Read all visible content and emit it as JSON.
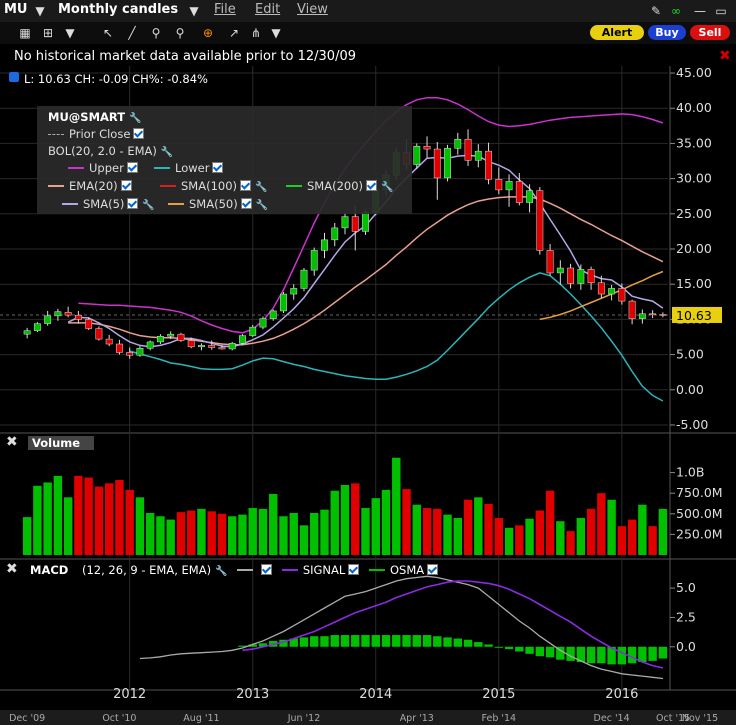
{
  "toolbar": {
    "symbol": "MU",
    "period": "Monthly candles",
    "menus": [
      "File",
      "Edit",
      "View"
    ],
    "alert": "Alert",
    "buy": "Buy",
    "sell": "Sell"
  },
  "notice": "No historical market data available prior to 12/30/09",
  "quote": "L: 10.63 CH: -0.09 CH%: -0.84%",
  "legend": {
    "symbol": "MU@SMART",
    "prior_close": "Prior Close",
    "bol": "BOL(20, 2.0 - EMA)",
    "upper": "Upper",
    "lower": "Lower",
    "ema20": "EMA(20)",
    "sma100": "SMA(100)",
    "sma200": "SMA(200)",
    "sma5": "SMA(5)",
    "sma50": "SMA(50)"
  },
  "volume_label": "Volume",
  "macd_label": "MACD",
  "macd_params": "(12, 26, 9 - EMA, EMA)",
  "macd_signal": "SIGNAL",
  "macd_osma": "OSMA",
  "last_price_label": "10.63",
  "colors": {
    "up": "#00c000",
    "down": "#e00000",
    "upper": "#cc33cc",
    "lower": "#2bb5bb",
    "ema20": "#e8a090",
    "sma50": "#e6a040",
    "sma5": "#b7a6e6",
    "macd": "#aaaaaa",
    "signal": "#8a2be2",
    "osma": "#00c000"
  },
  "chart_data": [
    {
      "type": "candlestick",
      "title": "MU Monthly candles",
      "ylim": [
        -6,
        46
      ],
      "yticks": [
        "45.00",
        "40.00",
        "35.00",
        "30.00",
        "25.00",
        "20.00",
        "15.00",
        "10.00",
        "5.00",
        "0.00",
        "-5.00"
      ],
      "ytick_values": [
        45,
        40,
        35,
        30,
        25,
        20,
        15,
        10,
        5,
        0,
        -5
      ],
      "xticks_upper": [
        "2012",
        "2013",
        "2014",
        "2015",
        "2016"
      ],
      "xticks_upper_index": [
        10,
        22,
        34,
        46,
        58
      ],
      "xticks_lower": [
        "Dec '09",
        "Oct '10",
        "Aug '11",
        "Jun '12",
        "Apr '13",
        "Feb '14",
        "Dec '14",
        "Oct '15",
        "Nov '15"
      ],
      "xticks_lower_index": [
        0,
        9,
        17,
        27,
        38,
        46,
        57,
        63,
        66
      ],
      "ohlc": [
        [
          7.9,
          8.8,
          7.3,
          8.4
        ],
        [
          8.4,
          9.6,
          8.2,
          9.4
        ],
        [
          9.4,
          11.2,
          9.1,
          10.5
        ],
        [
          10.5,
          11.5,
          9.8,
          11.1
        ],
        [
          11.0,
          11.8,
          10.3,
          10.6
        ],
        [
          10.6,
          11.2,
          9.4,
          10.0
        ],
        [
          10.0,
          10.3,
          8.5,
          8.7
        ],
        [
          8.7,
          9.0,
          7.0,
          7.2
        ],
        [
          7.2,
          7.8,
          6.2,
          6.5
        ],
        [
          6.5,
          7.1,
          5.0,
          5.3
        ],
        [
          5.3,
          6.0,
          4.4,
          4.9
        ],
        [
          4.9,
          6.2,
          4.7,
          5.9
        ],
        [
          5.9,
          7.0,
          5.6,
          6.8
        ],
        [
          6.8,
          7.9,
          6.5,
          7.6
        ],
        [
          7.6,
          8.3,
          7.2,
          7.9
        ],
        [
          7.9,
          8.1,
          6.8,
          7.0
        ],
        [
          7.0,
          7.4,
          5.9,
          6.1
        ],
        [
          6.1,
          6.6,
          5.6,
          6.3
        ],
        [
          6.3,
          7.0,
          5.7,
          6.0
        ],
        [
          6.0,
          6.4,
          5.7,
          5.8
        ],
        [
          5.8,
          6.8,
          5.6,
          6.6
        ],
        [
          6.6,
          7.9,
          6.4,
          7.7
        ],
        [
          7.7,
          9.2,
          7.5,
          8.9
        ],
        [
          8.9,
          10.4,
          8.6,
          10.1
        ],
        [
          10.1,
          11.4,
          9.8,
          11.2
        ],
        [
          11.2,
          13.9,
          10.9,
          13.6
        ],
        [
          13.6,
          15.0,
          12.8,
          14.4
        ],
        [
          14.4,
          17.3,
          14.0,
          17.0
        ],
        [
          17.0,
          20.2,
          16.2,
          19.8
        ],
        [
          19.8,
          22.3,
          18.7,
          21.3
        ],
        [
          21.3,
          23.7,
          20.4,
          23.0
        ],
        [
          23.0,
          25.2,
          22.1,
          24.6
        ],
        [
          24.6,
          26.2,
          19.8,
          22.5
        ],
        [
          22.5,
          25.6,
          22.0,
          25.2
        ],
        [
          25.2,
          29.0,
          24.8,
          28.4
        ],
        [
          28.4,
          31.2,
          27.6,
          30.5
        ],
        [
          30.5,
          34.3,
          29.8,
          33.7
        ],
        [
          33.7,
          35.6,
          31.2,
          32.0
        ],
        [
          32.0,
          35.0,
          31.4,
          34.6
        ],
        [
          34.6,
          36.0,
          33.0,
          34.2
        ],
        [
          34.2,
          35.2,
          27.0,
          30.1
        ],
        [
          30.1,
          34.8,
          29.6,
          34.3
        ],
        [
          34.3,
          36.5,
          33.4,
          35.6
        ],
        [
          35.6,
          37.0,
          31.8,
          32.6
        ],
        [
          32.6,
          34.9,
          31.6,
          33.9
        ],
        [
          33.9,
          35.1,
          29.2,
          29.9
        ],
        [
          29.9,
          31.6,
          27.8,
          28.4
        ],
        [
          28.4,
          30.6,
          26.0,
          29.6
        ],
        [
          29.6,
          30.8,
          26.2,
          26.6
        ],
        [
          26.6,
          29.2,
          25.2,
          28.3
        ],
        [
          28.3,
          28.8,
          19.2,
          19.8
        ],
        [
          19.8,
          20.7,
          16.2,
          16.6
        ],
        [
          16.6,
          18.4,
          14.9,
          17.3
        ],
        [
          17.3,
          17.9,
          14.4,
          15.1
        ],
        [
          15.1,
          17.8,
          14.2,
          17.1
        ],
        [
          17.1,
          17.5,
          14.2,
          15.2
        ],
        [
          15.2,
          16.2,
          13.0,
          13.6
        ],
        [
          13.6,
          14.9,
          12.7,
          14.4
        ],
        [
          14.4,
          15.1,
          12.1,
          12.6
        ],
        [
          12.6,
          12.8,
          9.3,
          10.1
        ],
        [
          10.1,
          11.4,
          9.4,
          10.8
        ],
        [
          10.8,
          11.3,
          10.2,
          10.7
        ],
        [
          10.7,
          11.0,
          10.3,
          10.63
        ]
      ],
      "series": [
        {
          "name": "Upper",
          "values": [
            null,
            null,
            null,
            null,
            null,
            12.3,
            12.2,
            12.1,
            12.0,
            12.0,
            11.9,
            11.8,
            11.7,
            11.5,
            11.3,
            11.0,
            10.5,
            9.8,
            9.2,
            8.7,
            8.3,
            8.1,
            8.6,
            9.8,
            11.6,
            14.2,
            17.3,
            20.5,
            23.7,
            26.6,
            29.1,
            31.4,
            33.3,
            35.0,
            36.7,
            38.2,
            39.5,
            40.5,
            41.2,
            41.5,
            41.5,
            41.2,
            40.6,
            39.8,
            38.9,
            38.1,
            37.6,
            37.4,
            37.5,
            37.7,
            38.0,
            38.3,
            38.5,
            38.7,
            38.8,
            38.9,
            39.0,
            39.1,
            39.2,
            39.1,
            38.8,
            38.4,
            37.9
          ]
        },
        {
          "name": "Lower",
          "values": [
            null,
            null,
            null,
            null,
            null,
            null,
            null,
            null,
            null,
            null,
            5.5,
            5.1,
            4.7,
            4.3,
            3.8,
            3.6,
            3.3,
            3.0,
            2.9,
            2.9,
            3.0,
            3.5,
            4.1,
            4.5,
            4.4,
            4.0,
            3.6,
            3.3,
            2.9,
            2.6,
            2.3,
            2.0,
            1.8,
            1.6,
            1.5,
            1.5,
            1.8,
            2.2,
            2.7,
            3.3,
            4.2,
            5.6,
            7.1,
            8.6,
            10.1,
            11.7,
            13.0,
            14.2,
            15.2,
            16.0,
            16.6,
            16.2,
            15.0,
            13.6,
            12.1,
            10.5,
            8.8,
            6.9,
            4.9,
            2.6,
            0.5,
            -0.8,
            -1.6
          ]
        },
        {
          "name": "EMA(20)",
          "values": [
            null,
            null,
            null,
            null,
            9.5,
            9.5,
            9.5,
            9.3,
            9.0,
            8.6,
            8.1,
            7.7,
            7.5,
            7.4,
            7.4,
            7.3,
            7.1,
            6.9,
            6.7,
            6.5,
            6.4,
            6.4,
            6.6,
            6.9,
            7.3,
            7.9,
            8.6,
            9.4,
            10.3,
            11.3,
            12.4,
            13.5,
            14.6,
            15.6,
            16.7,
            17.8,
            19.1,
            20.3,
            21.6,
            22.8,
            23.8,
            24.8,
            25.6,
            26.3,
            26.8,
            27.1,
            27.3,
            27.4,
            27.4,
            27.4,
            27.1,
            26.5,
            25.8,
            25.0,
            24.2,
            23.5,
            22.7,
            21.9,
            21.2,
            20.4,
            19.6,
            18.9,
            18.2
          ]
        },
        {
          "name": "SMA(50)",
          "values": [
            null,
            null,
            null,
            null,
            null,
            null,
            null,
            null,
            null,
            null,
            null,
            null,
            null,
            null,
            null,
            null,
            null,
            null,
            null,
            null,
            null,
            null,
            null,
            null,
            null,
            null,
            null,
            null,
            null,
            null,
            null,
            null,
            null,
            null,
            null,
            null,
            null,
            null,
            null,
            null,
            null,
            null,
            null,
            null,
            null,
            null,
            null,
            null,
            null,
            null,
            10.0,
            10.3,
            10.7,
            11.2,
            11.8,
            12.4,
            13.0,
            13.6,
            14.2,
            14.9,
            15.5,
            16.2,
            16.8
          ]
        },
        {
          "name": "SMA(5)",
          "values": [
            null,
            null,
            null,
            null,
            9.6,
            10.3,
            10.2,
            9.5,
            8.7,
            7.7,
            6.8,
            6.3,
            6.1,
            6.3,
            6.7,
            7.3,
            7.3,
            7.0,
            6.6,
            6.2,
            6.1,
            6.5,
            7.1,
            7.8,
            8.9,
            10.2,
            11.5,
            13.1,
            15.1,
            17.1,
            19.1,
            21.0,
            22.3,
            23.3,
            25.0,
            26.7,
            28.6,
            30.1,
            31.5,
            32.9,
            33.0,
            32.9,
            33.2,
            33.3,
            33.2,
            32.4,
            31.9,
            31.2,
            29.8,
            28.6,
            26.5,
            24.2,
            22.0,
            19.7,
            17.0,
            16.3,
            15.8,
            15.6,
            14.6,
            13.3,
            12.9,
            12.6,
            11.6
          ]
        }
      ]
    },
    {
      "type": "bar",
      "title": "Volume",
      "yticks": [
        "1.0B",
        "750.0M",
        "500.0M",
        "250.0M"
      ],
      "ytick_values": [
        1000,
        750,
        500,
        250
      ],
      "ylim": [
        0,
        1250
      ],
      "values": [
        460,
        840,
        880,
        960,
        700,
        960,
        940,
        830,
        870,
        910,
        790,
        700,
        510,
        470,
        430,
        520,
        540,
        560,
        530,
        500,
        470,
        490,
        570,
        560,
        740,
        470,
        510,
        360,
        510,
        550,
        780,
        850,
        870,
        570,
        690,
        790,
        1180,
        800,
        610,
        570,
        560,
        490,
        450,
        670,
        700,
        620,
        450,
        330,
        360,
        440,
        540,
        780,
        410,
        290,
        450,
        560,
        750,
        670,
        350,
        430,
        610,
        350,
        560
      ],
      "up": [
        true,
        true,
        true,
        true,
        true,
        false,
        false,
        false,
        false,
        false,
        false,
        true,
        true,
        true,
        true,
        false,
        false,
        true,
        false,
        false,
        true,
        true,
        true,
        true,
        true,
        true,
        true,
        true,
        true,
        true,
        true,
        true,
        false,
        true,
        true,
        true,
        true,
        false,
        true,
        false,
        false,
        true,
        true,
        false,
        true,
        false,
        false,
        true,
        false,
        true,
        false,
        false,
        true,
        false,
        true,
        false,
        false,
        true,
        false,
        false,
        true,
        false,
        true
      ]
    },
    {
      "type": "bar",
      "title": "MACD (12, 26, 9 - EMA, EMA)",
      "yticks": [
        "5.0",
        "2.5",
        "0.0"
      ],
      "ytick_values": [
        5,
        2.5,
        0
      ],
      "ylim": [
        -3,
        6.2
      ],
      "macd": [
        null,
        null,
        null,
        null,
        null,
        null,
        null,
        null,
        null,
        null,
        null,
        -1.0,
        -0.95,
        -0.85,
        -0.7,
        -0.6,
        -0.55,
        -0.5,
        -0.45,
        -0.4,
        -0.3,
        -0.1,
        0.2,
        0.5,
        0.9,
        1.3,
        1.8,
        2.3,
        2.8,
        3.3,
        3.8,
        4.3,
        4.5,
        4.7,
        5.0,
        5.3,
        5.6,
        5.8,
        5.9,
        6.0,
        5.9,
        5.7,
        5.5,
        5.3,
        5.0,
        4.3,
        3.6,
        2.9,
        2.2,
        1.6,
        0.9,
        0.3,
        -0.3,
        -0.8,
        -1.2,
        -1.6,
        -1.9,
        -2.1,
        -2.3,
        -2.4,
        -2.5,
        -2.6,
        -2.7
      ],
      "signal": [
        null,
        null,
        null,
        null,
        null,
        null,
        null,
        null,
        null,
        null,
        null,
        null,
        null,
        null,
        null,
        null,
        null,
        null,
        null,
        null,
        null,
        -0.3,
        -0.2,
        0.0,
        0.2,
        0.4,
        0.7,
        1.0,
        1.3,
        1.7,
        2.1,
        2.5,
        2.9,
        3.2,
        3.5,
        3.8,
        4.2,
        4.5,
        4.8,
        5.1,
        5.3,
        5.5,
        5.6,
        5.6,
        5.5,
        5.4,
        5.2,
        4.9,
        4.5,
        4.1,
        3.6,
        3.1,
        2.6,
        2.1,
        1.5,
        0.9,
        0.4,
        -0.1,
        -0.5,
        -0.9,
        -1.3,
        -1.6,
        -1.8
      ],
      "osma": [
        null,
        null,
        null,
        null,
        null,
        null,
        null,
        null,
        null,
        null,
        null,
        null,
        null,
        null,
        null,
        null,
        null,
        null,
        null,
        null,
        null,
        0.1,
        0.2,
        0.3,
        0.5,
        0.6,
        0.7,
        0.8,
        0.9,
        0.9,
        1.0,
        1.0,
        1.0,
        1.0,
        1.0,
        1.0,
        1.0,
        1.0,
        1.0,
        1.0,
        0.9,
        0.8,
        0.7,
        0.6,
        0.4,
        0.2,
        0.0,
        -0.2,
        -0.4,
        -0.6,
        -0.8,
        -0.9,
        -1.1,
        -1.2,
        -1.3,
        -1.4,
        -1.4,
        -1.5,
        -1.5,
        -1.4,
        -1.3,
        -1.2,
        -1.0
      ]
    }
  ]
}
